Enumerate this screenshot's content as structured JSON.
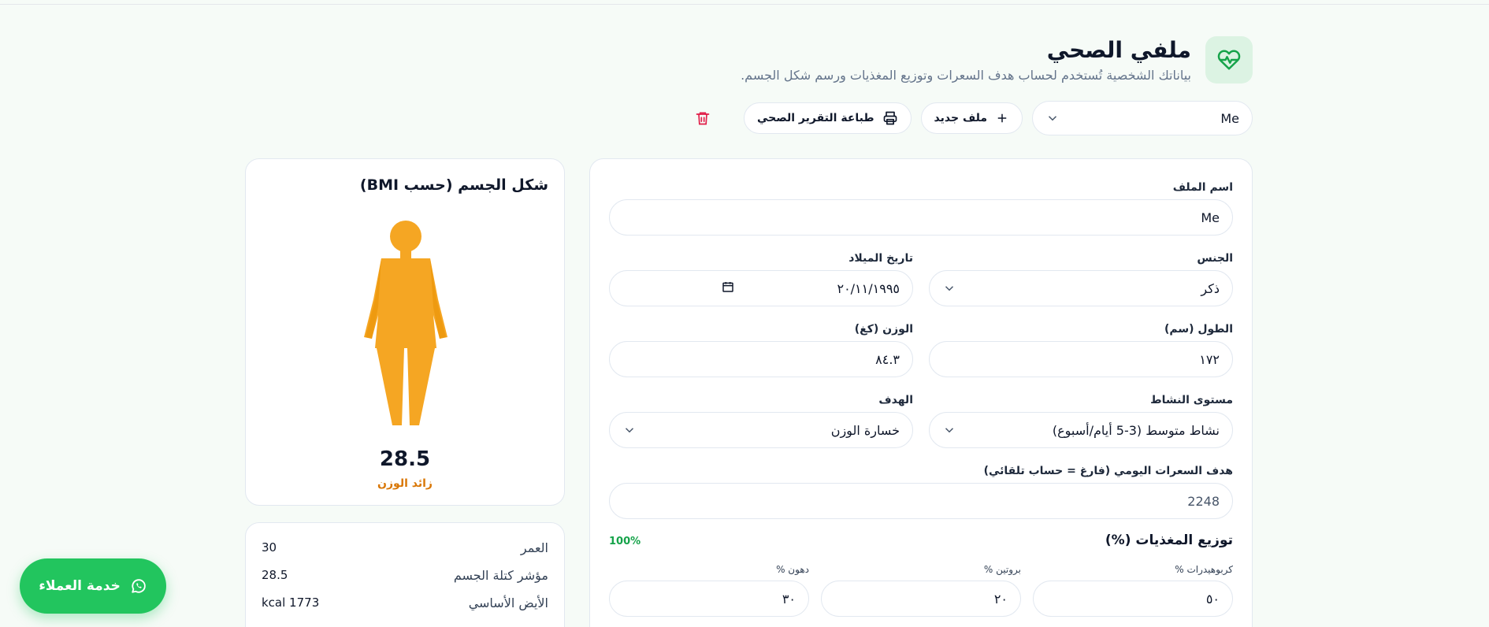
{
  "header": {
    "title": "ملفي الصحي",
    "subtitle": "بياناتك الشخصية تُستخدم لحساب هدف السعرات وتوزيع المغذيات ورسم شكل الجسم."
  },
  "toolbar": {
    "profile_selected": "Me",
    "new_profile_label": "ملف جديد",
    "print_label": "طباعة التقرير الصحي"
  },
  "form": {
    "profile_name": {
      "label": "اسم الملف",
      "value": "Me"
    },
    "gender": {
      "label": "الجنس",
      "value": "ذكر"
    },
    "birthdate": {
      "label": "تاريخ الميلاد",
      "value": "٢٠/١١/١٩٩٥"
    },
    "height": {
      "label": "الطول (سم)",
      "value": "١٧٢"
    },
    "weight": {
      "label": "الوزن (كغ)",
      "value": "٨٤.٣"
    },
    "activity": {
      "label": "مستوى النشاط",
      "value": "نشاط متوسط (3-5 أيام/أسبوع)"
    },
    "goal": {
      "label": "الهدف",
      "value": "خسارة الوزن"
    },
    "calories": {
      "label": "هدف السعرات اليومي (فارغ = حساب تلقائي)",
      "placeholder": "2248"
    },
    "macros": {
      "title": "توزيع المغذيات (%)",
      "total": "100%",
      "carbs": {
        "label": "كربوهيدرات %",
        "value": "٥٠"
      },
      "protein": {
        "label": "بروتين %",
        "value": "٢٠"
      },
      "fat": {
        "label": "دهون %",
        "value": "٣٠"
      }
    }
  },
  "body_shape": {
    "title": "شكل الجسم (حسب BMI)",
    "bmi_value": "28.5",
    "bmi_status": "زائد الوزن",
    "figure_color": "#f5a623"
  },
  "stats": [
    {
      "label": "العمر",
      "value": "30"
    },
    {
      "label": "مؤشر كتلة الجسم",
      "value": "28.5"
    },
    {
      "label": "الأيض الأساسي",
      "value": "kcal 1773"
    }
  ],
  "support": {
    "label": "خدمة العملاء"
  },
  "colors": {
    "accent": "#16a34a",
    "whatsapp": "#22c55e",
    "warning": "#d97706",
    "danger": "#e11d48"
  }
}
